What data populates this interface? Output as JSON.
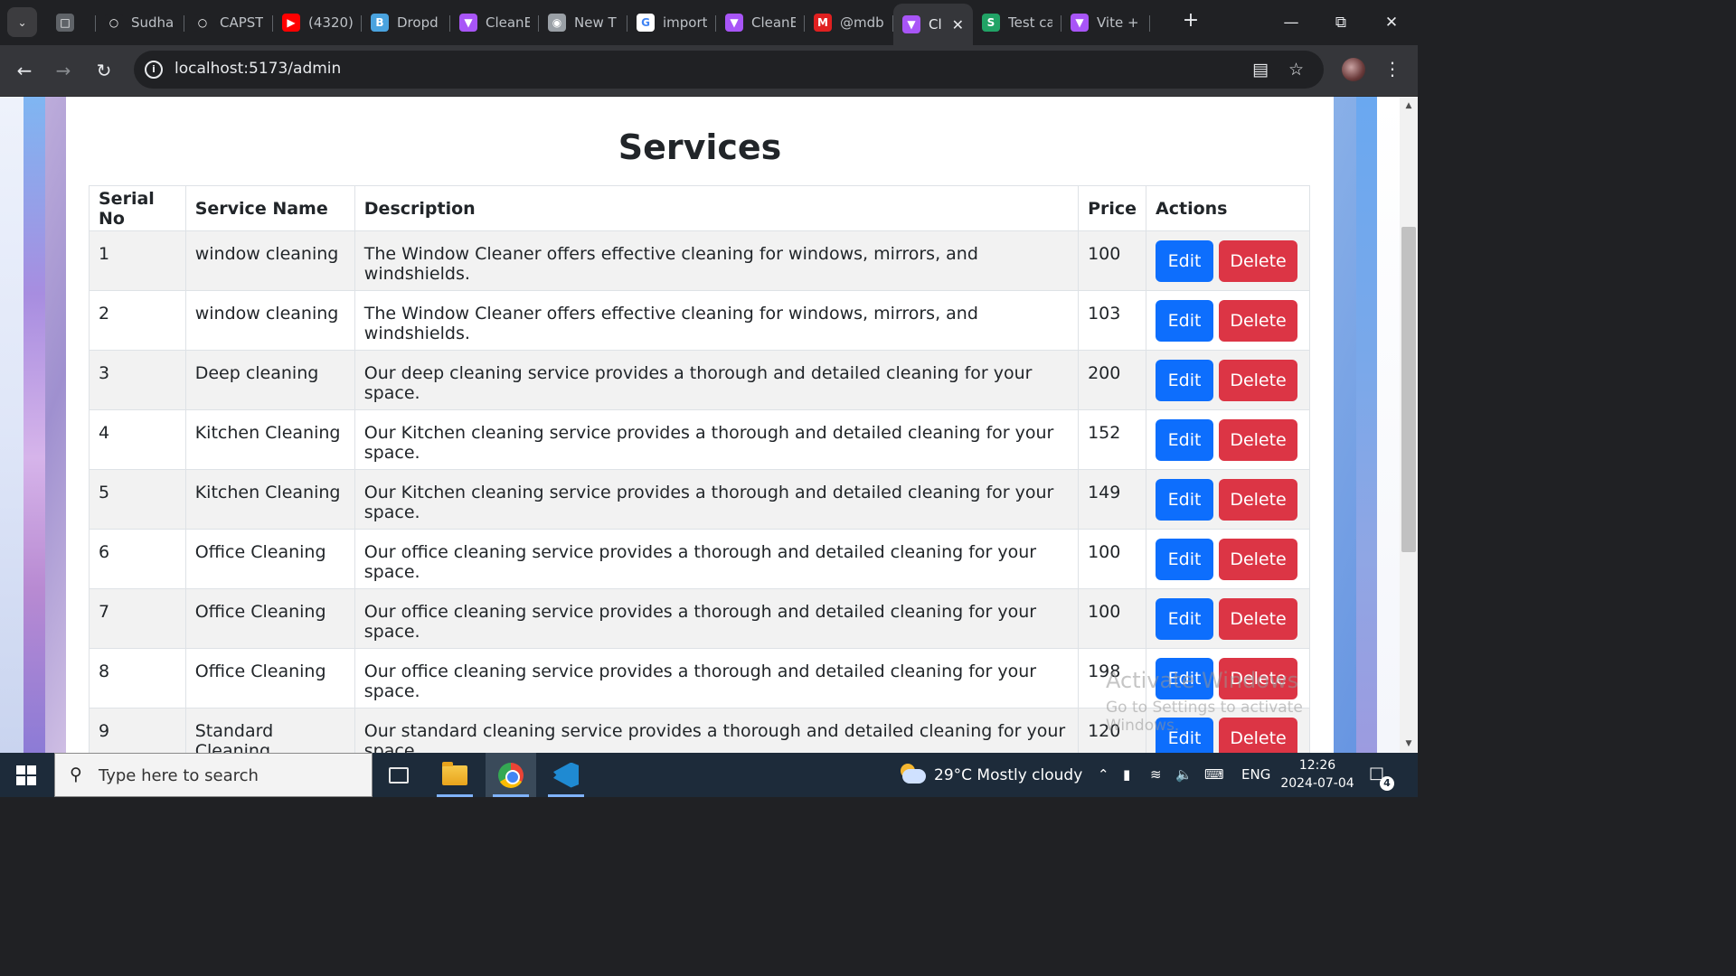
{
  "browser": {
    "tab_search_icon": "chevron-down-icon",
    "tabs": [
      {
        "title": "",
        "favicon": "page-icon",
        "color": "#5f6368"
      },
      {
        "title": "Sudha",
        "favicon": "github-icon",
        "color": "#202124"
      },
      {
        "title": "CAPST",
        "favicon": "github-icon",
        "color": "#202124"
      },
      {
        "title": "(4320)",
        "favicon": "youtube-icon",
        "color": "#ff0000"
      },
      {
        "title": "Dropd",
        "favicon": "bootstrap-icon",
        "color": "#4aa3df"
      },
      {
        "title": "CleanE",
        "favicon": "vite-icon",
        "color": "#a855f7"
      },
      {
        "title": "New T",
        "favicon": "chrome-icon",
        "color": "#9aa0a6"
      },
      {
        "title": "import",
        "favicon": "google-icon",
        "color": "#ffffff"
      },
      {
        "title": "CleanE",
        "favicon": "vite-icon",
        "color": "#a855f7"
      },
      {
        "title": "@mdb",
        "favicon": "mdb-icon",
        "color": "#e02020"
      },
      {
        "title": "Cl",
        "favicon": "vite-icon",
        "color": "#a855f7",
        "active": true
      },
      {
        "title": "Test ca",
        "favicon": "s-icon",
        "color": "#21a366"
      },
      {
        "title": "Vite +",
        "favicon": "vite-icon",
        "color": "#a855f7"
      }
    ],
    "url": "localhost:5173/admin"
  },
  "page": {
    "title": "Services",
    "table": {
      "headers": [
        "Serial No",
        "Service Name",
        "Description",
        "Price",
        "Actions"
      ],
      "rows": [
        {
          "serial": "1",
          "name": "window cleaning",
          "description": "The Window Cleaner offers effective cleaning for windows, mirrors, and windshields.",
          "price": "100"
        },
        {
          "serial": "2",
          "name": "window cleaning",
          "description": "The Window Cleaner offers effective cleaning for windows, mirrors, and windshields.",
          "price": "103"
        },
        {
          "serial": "3",
          "name": "Deep cleaning",
          "description": "Our deep cleaning service provides a thorough and detailed cleaning for your space.",
          "price": "200"
        },
        {
          "serial": "4",
          "name": "Kitchen Cleaning",
          "description": "Our Kitchen cleaning service provides a thorough and detailed cleaning for your space.",
          "price": "152"
        },
        {
          "serial": "5",
          "name": "Kitchen Cleaning",
          "description": "Our Kitchen cleaning service provides a thorough and detailed cleaning for your space.",
          "price": "149"
        },
        {
          "serial": "6",
          "name": "Office Cleaning",
          "description": "Our office cleaning service provides a thorough and detailed cleaning for your space.",
          "price": "100"
        },
        {
          "serial": "7",
          "name": "Office Cleaning",
          "description": "Our office cleaning service provides a thorough and detailed cleaning for your space.",
          "price": "100"
        },
        {
          "serial": "8",
          "name": "Office Cleaning",
          "description": "Our office cleaning service provides a thorough and detailed cleaning for your space.",
          "price": "198"
        },
        {
          "serial": "9",
          "name": "Standard Cleaning",
          "description": "Our standard cleaning service provides a thorough and detailed cleaning for your space.",
          "price": "120"
        }
      ],
      "edit_label": "Edit",
      "delete_label": "Delete",
      "edit_color": "#0d6efd",
      "delete_color": "#dc3545"
    },
    "watermark": {
      "line1": "Activate Windows",
      "line2": "Go to Settings to activate Windows."
    }
  },
  "taskbar": {
    "search_placeholder": "Type here to search",
    "weather": "29°C  Mostly cloudy",
    "language": "ENG",
    "time": "12:26",
    "date": "2024-07-04",
    "notification_count": "4"
  }
}
